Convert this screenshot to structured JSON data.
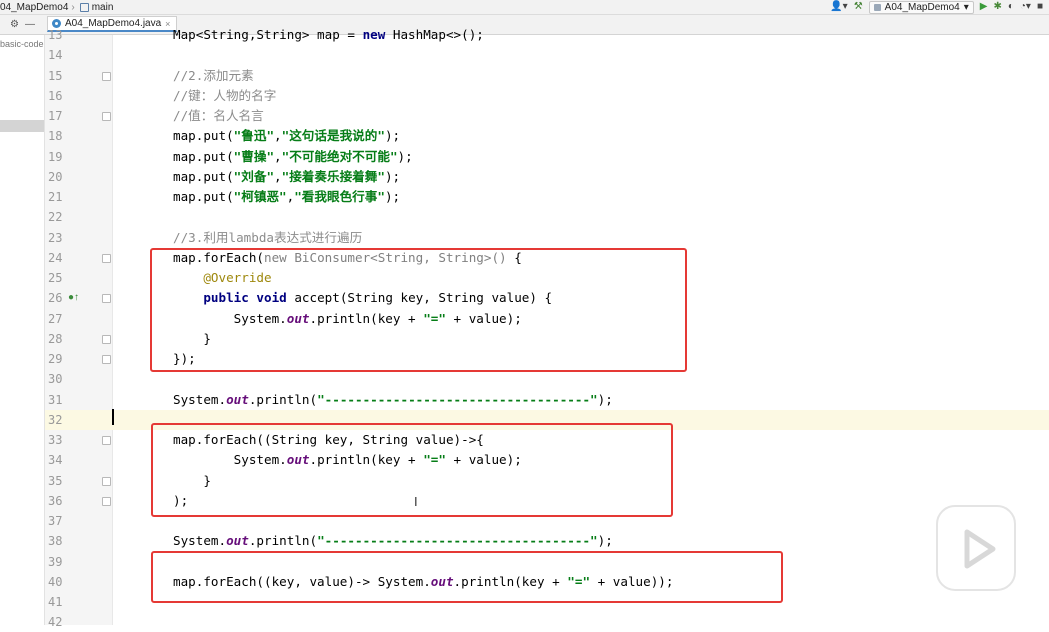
{
  "nav": {
    "project": "04_MapDemo4",
    "branch": "main",
    "run_config": "A04_MapDemo4"
  },
  "tab": {
    "label": "A04_MapDemo4.java"
  },
  "project_panel": {
    "node": "basic-code"
  },
  "editor": {
    "lines": [
      {
        "n": "13",
        "segs": [
          [
            "plain",
            "Map<String,String> map = "
          ],
          [
            "kw",
            "new"
          ],
          [
            "plain",
            " HashMap<>();"
          ]
        ]
      },
      {
        "n": "14",
        "segs": []
      },
      {
        "n": "15",
        "fold": true,
        "segs": [
          [
            "com",
            "//2.添加元素"
          ]
        ]
      },
      {
        "n": "16",
        "segs": [
          [
            "com",
            "//键：人物的名字"
          ]
        ]
      },
      {
        "n": "17",
        "fold": true,
        "segs": [
          [
            "com",
            "//值：名人名言"
          ]
        ]
      },
      {
        "n": "18",
        "segs": [
          [
            "plain",
            "map.put("
          ],
          [
            "str",
            "\"鲁迅\""
          ],
          [
            "plain",
            ","
          ],
          [
            "str",
            "\"这句话是我说的\""
          ],
          [
            "plain",
            ");"
          ]
        ]
      },
      {
        "n": "19",
        "segs": [
          [
            "plain",
            "map.put("
          ],
          [
            "str",
            "\"曹操\""
          ],
          [
            "plain",
            ","
          ],
          [
            "str",
            "\"不可能绝对不可能\""
          ],
          [
            "plain",
            ");"
          ]
        ]
      },
      {
        "n": "20",
        "segs": [
          [
            "plain",
            "map.put("
          ],
          [
            "str",
            "\"刘备\""
          ],
          [
            "plain",
            ","
          ],
          [
            "str",
            "\"接着奏乐接着舞\""
          ],
          [
            "plain",
            ");"
          ]
        ]
      },
      {
        "n": "21",
        "segs": [
          [
            "plain",
            "map.put("
          ],
          [
            "str",
            "\"柯镇恶\""
          ],
          [
            "plain",
            ","
          ],
          [
            "str",
            "\"看我眼色行事\""
          ],
          [
            "plain",
            ");"
          ]
        ]
      },
      {
        "n": "22",
        "segs": []
      },
      {
        "n": "23",
        "segs": [
          [
            "com",
            "//3.利用lambda表达式进行遍历"
          ]
        ]
      },
      {
        "n": "24",
        "fold": true,
        "segs": [
          [
            "plain",
            "map.forEach("
          ],
          [
            "gray",
            "new BiConsumer<String, String>() "
          ],
          [
            "plain",
            "{"
          ]
        ]
      },
      {
        "n": "25",
        "segs": [
          [
            "plain",
            "    "
          ],
          [
            "ann",
            "@Override"
          ]
        ]
      },
      {
        "n": "26",
        "fold": true,
        "override": true,
        "segs": [
          [
            "plain",
            "    "
          ],
          [
            "kw",
            "public void"
          ],
          [
            "plain",
            " accept(String key, String value) {"
          ]
        ]
      },
      {
        "n": "27",
        "segs": [
          [
            "plain",
            "        System."
          ],
          [
            "ital",
            "out"
          ],
          [
            "plain",
            ".println(key + "
          ],
          [
            "str",
            "\"=\""
          ],
          [
            "plain",
            " + value);"
          ]
        ]
      },
      {
        "n": "28",
        "fold": true,
        "segs": [
          [
            "plain",
            "    }"
          ]
        ]
      },
      {
        "n": "29",
        "fold": true,
        "segs": [
          [
            "plain",
            "});"
          ]
        ]
      },
      {
        "n": "30",
        "segs": []
      },
      {
        "n": "31",
        "segs": [
          [
            "plain",
            "System."
          ],
          [
            "ital",
            "out"
          ],
          [
            "plain",
            ".println("
          ],
          [
            "str",
            "\"-----------------------------------\""
          ],
          [
            "plain",
            ");"
          ]
        ]
      },
      {
        "n": "32",
        "current": true,
        "segs": []
      },
      {
        "n": "33",
        "fold": true,
        "segs": [
          [
            "plain",
            "map.forEach((String key, String value)->{"
          ]
        ]
      },
      {
        "n": "34",
        "segs": [
          [
            "plain",
            "        System."
          ],
          [
            "ital",
            "out"
          ],
          [
            "plain",
            ".println(key + "
          ],
          [
            "str",
            "\"=\""
          ],
          [
            "plain",
            " + value);"
          ]
        ]
      },
      {
        "n": "35",
        "fold": true,
        "segs": [
          [
            "plain",
            "    }"
          ]
        ]
      },
      {
        "n": "36",
        "fold": true,
        "segs": [
          [
            "plain",
            ");"
          ]
        ]
      },
      {
        "n": "37",
        "segs": []
      },
      {
        "n": "38",
        "segs": [
          [
            "plain",
            "System."
          ],
          [
            "ital",
            "out"
          ],
          [
            "plain",
            ".println("
          ],
          [
            "str",
            "\"-----------------------------------\""
          ],
          [
            "plain",
            ");"
          ]
        ]
      },
      {
        "n": "39",
        "segs": []
      },
      {
        "n": "40",
        "segs": [
          [
            "plain",
            "map.forEach((key, value)-> System."
          ],
          [
            "ital",
            "out"
          ],
          [
            "plain",
            ".println(key + "
          ],
          [
            "str",
            "\"=\""
          ],
          [
            "plain",
            " + value));"
          ]
        ]
      },
      {
        "n": "41",
        "segs": []
      },
      {
        "n": "42",
        "segs": []
      }
    ]
  },
  "colors": {
    "highlight_border": "#e53935",
    "comment": "#8c8c8c",
    "keyword": "#000080",
    "string": "#067d17",
    "static_field": "#660e7a",
    "annotation": "#9e880d",
    "current_line": "#fcf9e3"
  }
}
